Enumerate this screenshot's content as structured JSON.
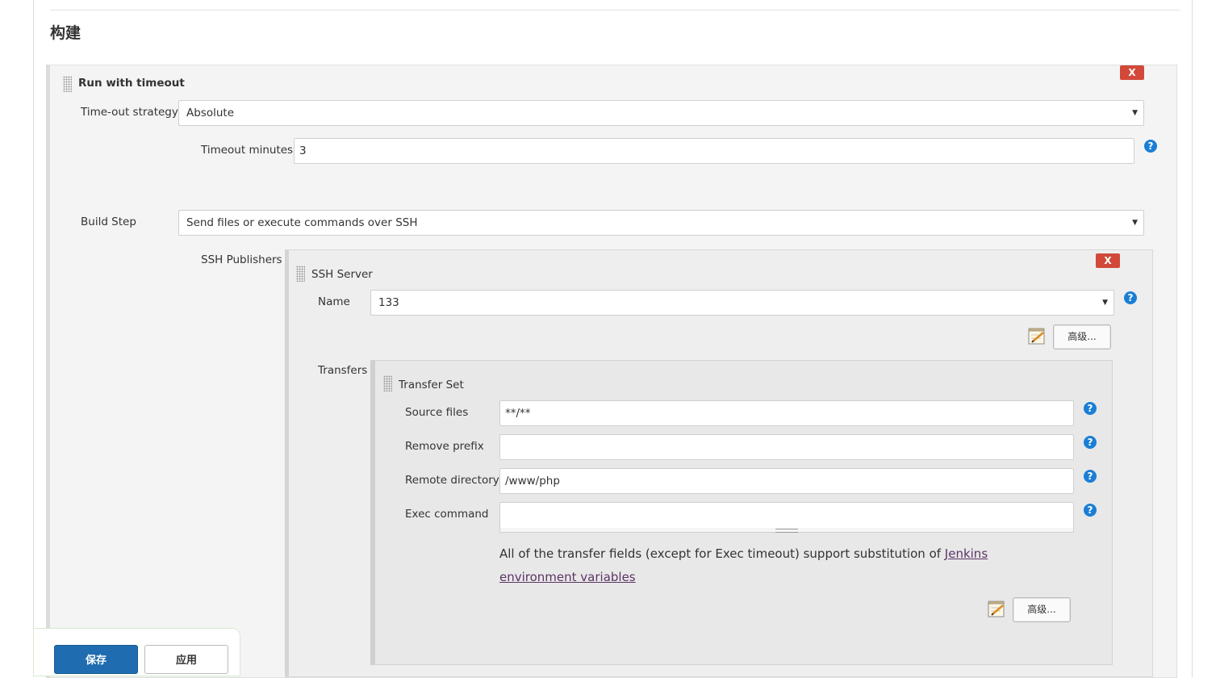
{
  "section": {
    "title": "构建"
  },
  "run_with_timeout": {
    "title": "Run with timeout",
    "delete_label": "X",
    "strategy_label": "Time-out strategy",
    "strategy_value": "Absolute",
    "minutes_label": "Timeout minutes",
    "minutes_value": "3"
  },
  "build_step": {
    "label": "Build Step",
    "value": "Send files or execute commands over SSH"
  },
  "ssh": {
    "publishers_label": "SSH Publishers",
    "server_title": "SSH Server",
    "delete_label": "X",
    "name_label": "Name",
    "name_value": "133",
    "advanced_label": "高级...",
    "transfers_label": "Transfers",
    "transfer_set": {
      "title": "Transfer Set",
      "source_files_label": "Source files",
      "source_files_value": "**/**",
      "remove_prefix_label": "Remove prefix",
      "remove_prefix_value": "",
      "remote_dir_label": "Remote directory",
      "remote_dir_value": "/www/php",
      "exec_command_label": "Exec command",
      "exec_command_value": "",
      "info_text": "All of the transfer fields (except for Exec timeout) support substitution of ",
      "info_link": "Jenkins environment variables",
      "advanced_label": "高级..."
    }
  },
  "help_symbol": "?",
  "footer": {
    "save_label": "保存",
    "apply_label": "应用"
  },
  "colors": {
    "delete": "#d24939",
    "help": "#1a7ed6",
    "save": "#1f6db0",
    "link": "#5c3566"
  },
  "icons": [
    "drag-handle-icon",
    "help-icon",
    "notepad-edit-icon",
    "select-caret-icon"
  ]
}
